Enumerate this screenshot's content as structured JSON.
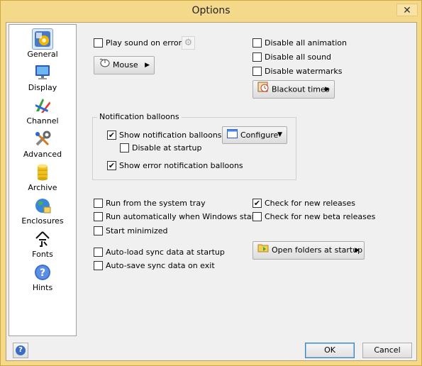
{
  "window": {
    "title": "Options",
    "close_glyph": "✕"
  },
  "sidebar": {
    "items": [
      {
        "label": "General",
        "icon": "general-icon",
        "selected": true
      },
      {
        "label": "Display",
        "icon": "monitor-icon"
      },
      {
        "label": "Channel",
        "icon": "channel-icon"
      },
      {
        "label": "Advanced",
        "icon": "tools-icon"
      },
      {
        "label": "Archive",
        "icon": "database-icon"
      },
      {
        "label": "Enclosures",
        "icon": "globe-icon"
      },
      {
        "label": "Fonts",
        "icon": "font-icon"
      },
      {
        "label": "Hints",
        "icon": "help-icon"
      }
    ]
  },
  "general": {
    "play_sound": {
      "label": "Play sound on error",
      "checked": false
    },
    "mouse_button": "Mouse",
    "disable_animation": {
      "label": "Disable all animation",
      "checked": false
    },
    "disable_sound": {
      "label": "Disable all sound",
      "checked": false
    },
    "disable_watermarks": {
      "label": "Disable watermarks",
      "checked": false
    },
    "blackout_button": "Blackout times",
    "notification_group": {
      "title": "Notification balloons",
      "show_balloons": {
        "label": "Show notification balloons",
        "checked": true
      },
      "disable_startup": {
        "label": "Disable at startup",
        "checked": false
      },
      "show_error_balloons": {
        "label": "Show error notification balloons",
        "checked": true
      },
      "configure_button": "Configure"
    },
    "run_tray": {
      "label": "Run from the system tray",
      "checked": false
    },
    "run_auto": {
      "label": "Run automatically when Windows starts",
      "checked": false
    },
    "start_min": {
      "label": "Start minimized",
      "checked": false
    },
    "check_releases": {
      "label": "Check for new releases",
      "checked": true
    },
    "check_beta": {
      "label": "Check for new beta releases",
      "checked": false
    },
    "autoload": {
      "label": "Auto-load sync data at startup",
      "checked": false
    },
    "autosave": {
      "label": "Auto-save sync data on exit",
      "checked": false
    },
    "open_folders_button": "Open folders at startup"
  },
  "footer": {
    "ok": "OK",
    "cancel": "Cancel"
  }
}
